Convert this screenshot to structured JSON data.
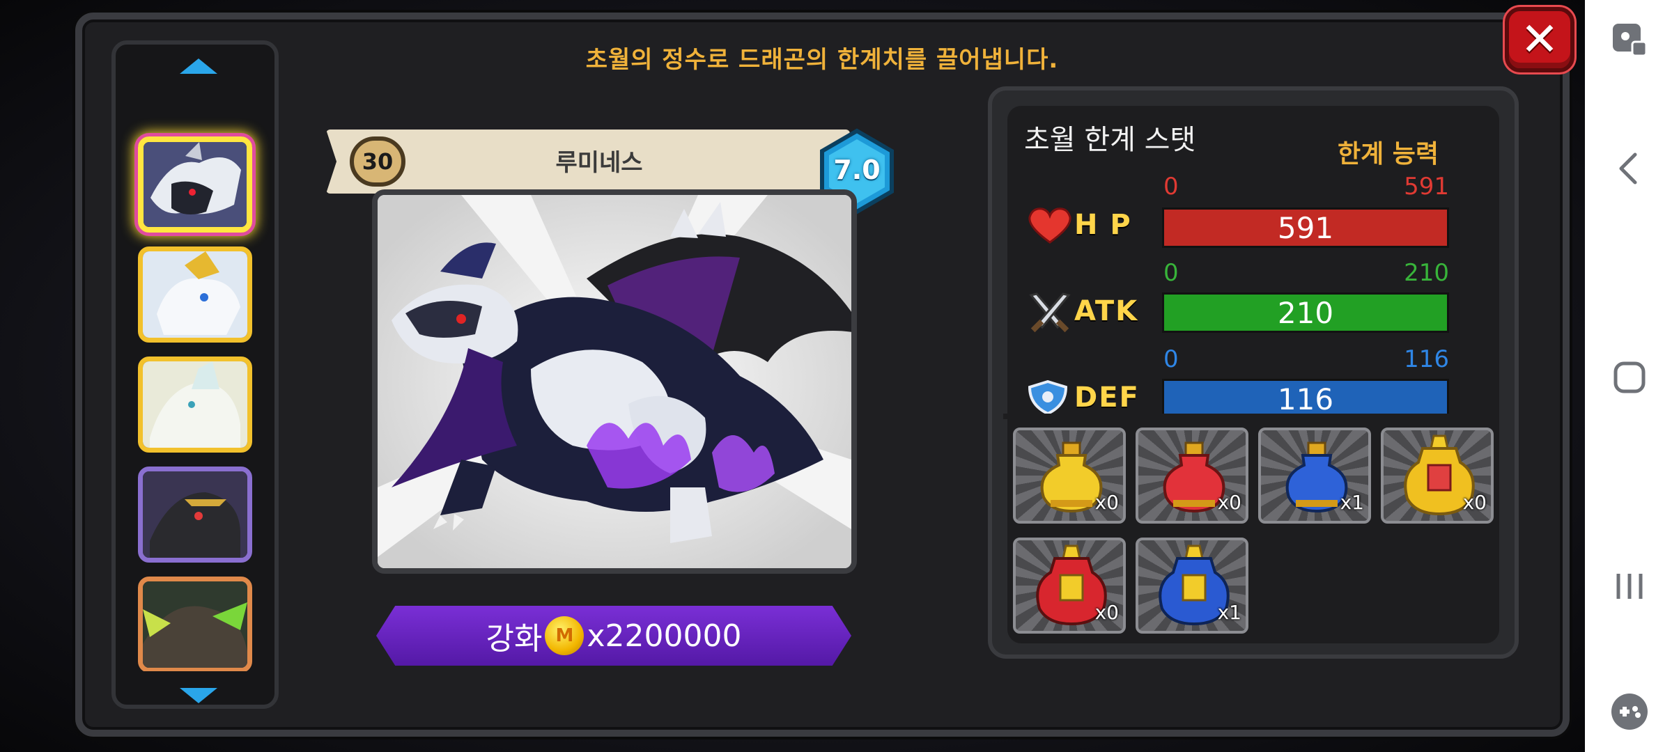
{
  "header": {
    "subtitle": "초월의 정수로 드래곤의 한계치를 끌어냅니다."
  },
  "dragon": {
    "name": "루미네스",
    "level": "30",
    "grade": "7.0"
  },
  "upgrade": {
    "label": "강화",
    "coin_symbol": "M",
    "cost": "x2200000"
  },
  "stats": {
    "title": "초월 한계 스탯",
    "limit_label": "한계 능력",
    "hp": {
      "label": "H P",
      "min": "0",
      "max": "591",
      "value": "591",
      "fraction": 1.0,
      "color": "#c22a24",
      "text_color": "#e03a33"
    },
    "atk": {
      "label": "ATK",
      "min": "0",
      "max": "210",
      "value": "210",
      "fraction": 1.0,
      "color": "#22a024",
      "text_color": "#38b43a"
    },
    "def": {
      "label": "DEF",
      "min": "0",
      "max": "116",
      "value": "116",
      "fraction": 1.0,
      "color": "#1f63b8",
      "text_color": "#2f86e6"
    }
  },
  "potions": [
    {
      "count": "x0",
      "color": "yellow"
    },
    {
      "count": "x0",
      "color": "red"
    },
    {
      "count": "x1",
      "color": "blue"
    },
    {
      "count": "x0",
      "color": "yellow-large"
    },
    {
      "count": "x0",
      "color": "red-large"
    },
    {
      "count": "x1",
      "color": "blue-large"
    }
  ],
  "icons": {
    "close": "close-icon",
    "hp": "heart-icon",
    "atk": "crossed-swords-icon",
    "def": "shield-icon",
    "nav": [
      "screen-touch-icon",
      "back-icon",
      "home-icon",
      "recents-icon",
      "game-tools-icon"
    ]
  }
}
